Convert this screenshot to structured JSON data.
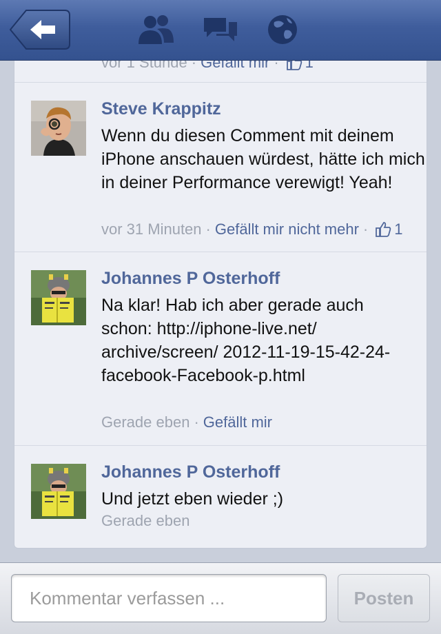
{
  "nav": {
    "back_icon": "back-arrow-icon",
    "icons": [
      "friends-icon",
      "messages-icon",
      "globe-icon"
    ],
    "bar_color": "#3f5d9c"
  },
  "partial_comment": {
    "time": "vor 1 Stunde",
    "like_label": "Gefällt mir",
    "like_count": "1"
  },
  "comments": [
    {
      "author": "Steve Krappitz",
      "text": "Wenn du diesen Comment mit deinem iPhone anschauen würdest, hätte ich mich in deiner Performance verewigt! Yeah!",
      "time": "vor 31 Minuten",
      "like_label": "Gefällt mir nicht mehr",
      "like_count": "1"
    },
    {
      "author": "Johannes P Osterhoff",
      "text": "Na klar! Hab ich aber gerade auch schon: http://iphone-live.net/ archive/screen/ 2012-11-19-15-42-24-facebook-Facebook-p.html",
      "time": "Gerade eben",
      "like_label": "Gefällt mir"
    },
    {
      "author": "Johannes P Osterhoff",
      "text": "Und jetzt eben wieder ;)",
      "time": "Gerade eben"
    }
  ],
  "composer": {
    "placeholder": "Kommentar verfassen ...",
    "post_label": "Posten"
  },
  "colors": {
    "link": "#50679a",
    "meta": "#9ea4b0",
    "card_bg": "#edeff5"
  }
}
